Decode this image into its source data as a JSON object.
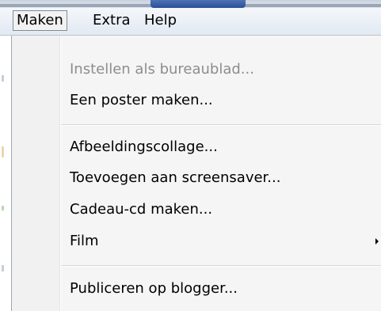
{
  "menubar": {
    "items": [
      {
        "label": "Maken",
        "active": true
      },
      {
        "label": "Extra",
        "active": false
      },
      {
        "label": "Help",
        "active": false
      }
    ]
  },
  "menu": {
    "items": [
      {
        "label": "Instellen als bureaublad...",
        "enabled": false
      },
      {
        "label": "Een poster maken...",
        "enabled": true
      },
      {
        "label": "Afbeeldingscollage...",
        "enabled": true
      },
      {
        "label": "Toevoegen aan screensaver...",
        "enabled": true
      },
      {
        "label": "Cadeau-cd maken...",
        "enabled": true
      },
      {
        "label": "Film",
        "enabled": true,
        "submenu": true
      },
      {
        "label": "Publiceren op blogger...",
        "enabled": true
      }
    ]
  },
  "colors": {
    "menu_background": "#f5f5f5",
    "disabled_text": "#8d8d8d",
    "active_border": "#7f8c99"
  }
}
